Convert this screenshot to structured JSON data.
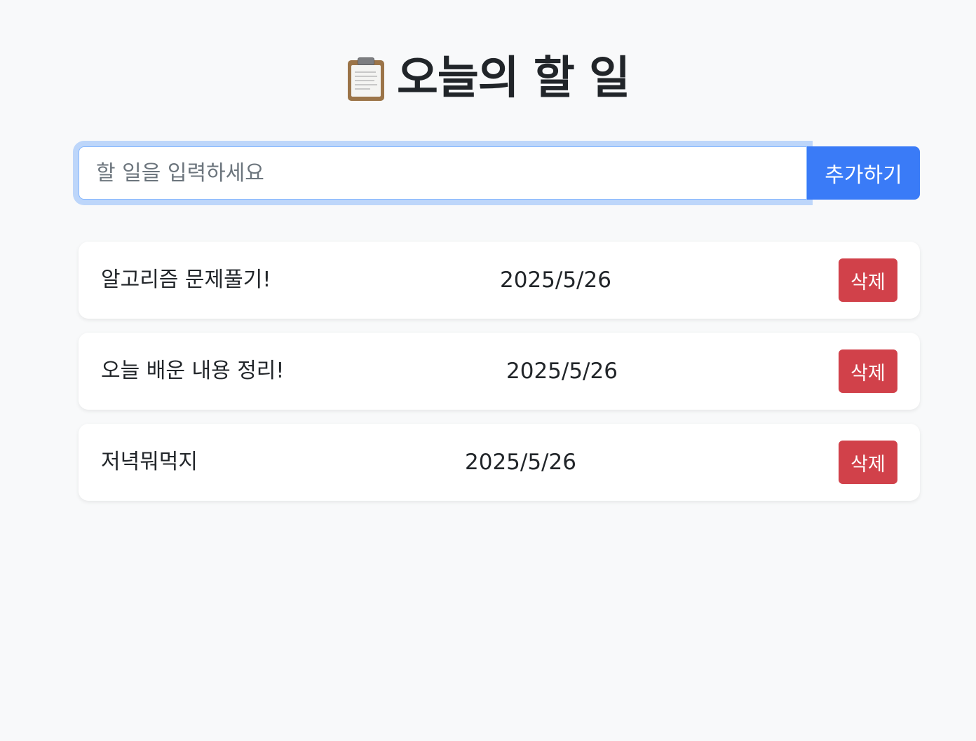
{
  "header": {
    "icon": "clipboard-icon",
    "title": "오늘의 할 일"
  },
  "form": {
    "input_value": "",
    "input_placeholder": "할 일을 입력하세요",
    "add_label": "추가하기"
  },
  "colors": {
    "background": "#f8f9fa",
    "primary": "#3a7bf7",
    "danger": "#d1414a",
    "focus_ring": "#86b7fe"
  },
  "todos": [
    {
      "text": "알고리즘 문제풀기!",
      "date": "2025/5/26",
      "delete_label": "삭제"
    },
    {
      "text": "오늘 배운 내용 정리!",
      "date": "2025/5/26",
      "delete_label": "삭제"
    },
    {
      "text": "저녁뭐먹지",
      "date": "2025/5/26",
      "delete_label": "삭제"
    }
  ]
}
